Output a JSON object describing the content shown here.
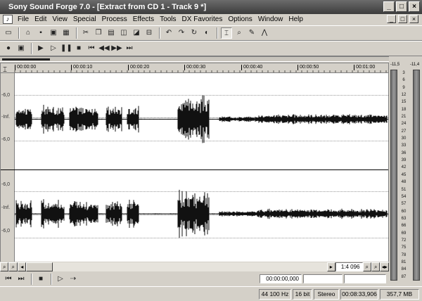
{
  "window": {
    "title": "Sony Sound Forge 7.0 - [Extract from CD 1 - Track 9 *]",
    "min": "_",
    "max": "□",
    "close": "×"
  },
  "menu": {
    "icon": "♪",
    "items": [
      "File",
      "Edit",
      "View",
      "Special",
      "Process",
      "Effects",
      "Tools",
      "DX Favorites",
      "Options",
      "Window",
      "Help"
    ]
  },
  "ruler": {
    "ticks": [
      "00:00:00",
      "00:00:10",
      "00:00:20",
      "00:00:30",
      "00:00:40",
      "00:00:50",
      "00:01:00"
    ]
  },
  "gutter": {
    "top": [
      "-6,0",
      "-Inf.",
      "-6,0"
    ],
    "bottom": [
      "-6,0",
      "-Inf.",
      "-6,0"
    ]
  },
  "meter": {
    "left_header": "-11,5",
    "right_header": "-11,4",
    "scale": [
      "3",
      "6",
      "9",
      "12",
      "15",
      "18",
      "21",
      "24",
      "27",
      "30",
      "33",
      "36",
      "39",
      "42",
      "45",
      "48",
      "51",
      "54",
      "57",
      "60",
      "63",
      "66",
      "69",
      "72",
      "75",
      "78",
      "81",
      "84",
      "87"
    ]
  },
  "scroll": {
    "zoom_ratio": "1:4 096"
  },
  "transport": {
    "position": "00:00:00,000",
    "field2": "",
    "field3": ""
  },
  "status": {
    "sample_rate": "44 100 Hz",
    "bit_depth": "16 bit",
    "channels": "Stereo",
    "length": "00:08:33,906",
    "size": "357,7 MB"
  }
}
